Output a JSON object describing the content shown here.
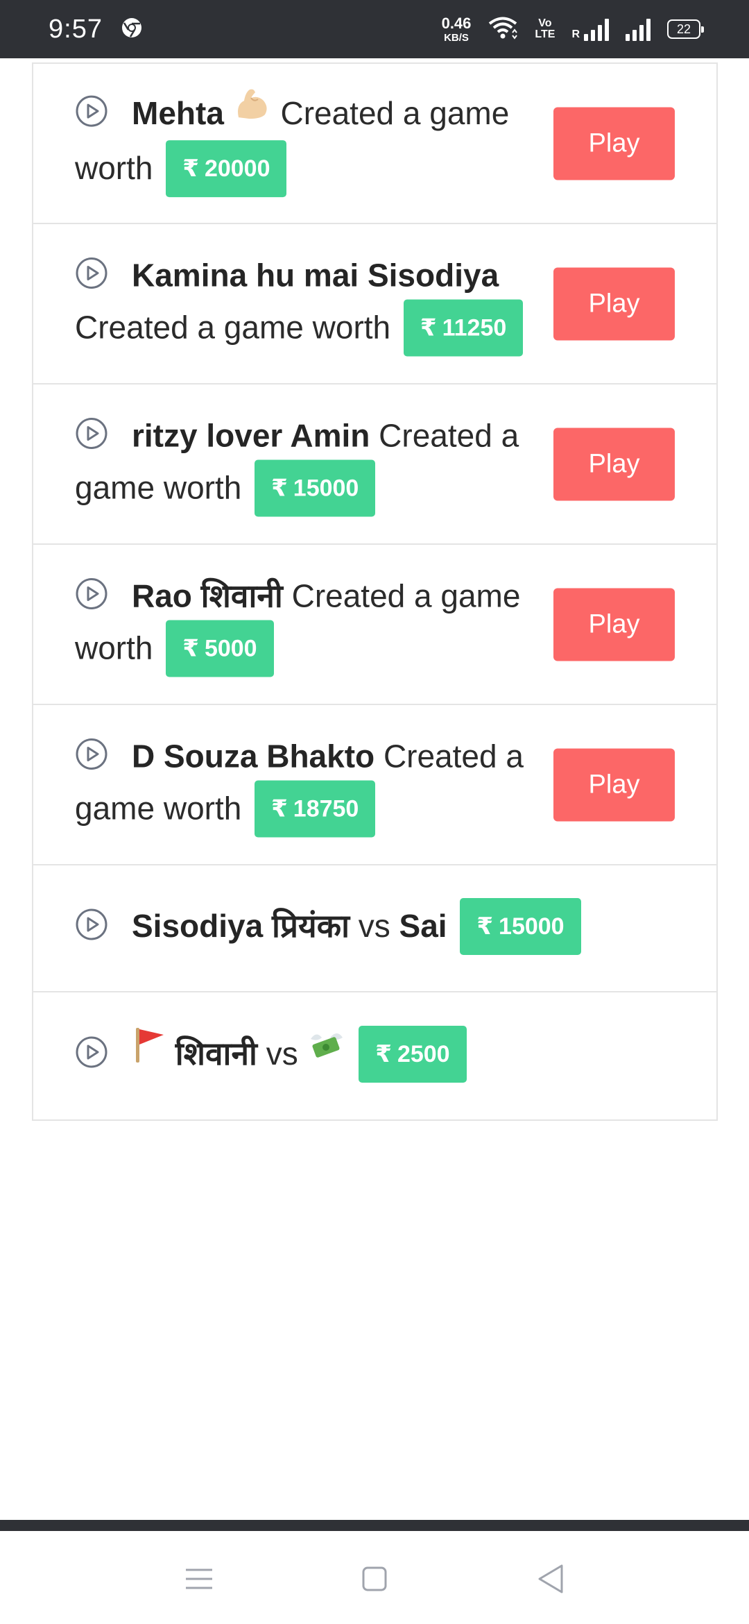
{
  "status_bar": {
    "time": "9:57",
    "net_speed_value": "0.46",
    "net_speed_unit": "KB/S",
    "volte_top": "Vo",
    "volte_bottom": "LTE",
    "roaming": "R",
    "battery": "22"
  },
  "colors": {
    "play_button": "#fc6767",
    "amount_badge": "#43d393",
    "status_bar": "#2f3136"
  },
  "currency_symbol": "₹",
  "games": [
    {
      "player": "Mehta",
      "emoji": "muscle-emoji",
      "text": "Created a game worth",
      "amount": "20000",
      "button": "Play"
    },
    {
      "player": "Kamina hu mai Sisodiya",
      "text": "Created a game worth",
      "amount": "11250",
      "button": "Play"
    },
    {
      "player": "ritzy lover Amin",
      "text": "Created a game worth",
      "amount": "15000",
      "button": "Play"
    },
    {
      "player": "Rao शिवानी",
      "text": "Created a game worth",
      "amount": "5000",
      "button": "Play"
    },
    {
      "player": "D Souza Bhakto",
      "text": "Created a game worth",
      "amount": "18750",
      "button": "Play"
    }
  ],
  "matches": [
    {
      "player1": "Sisodiya प्रियंका",
      "vs": "vs",
      "player2": "Sai",
      "amount": "15000"
    },
    {
      "player1_emoji": "red-flag-emoji",
      "player1": "शिवानी",
      "vs": "vs",
      "player2_emoji": "money-with-wings-emoji",
      "amount": "2500"
    }
  ],
  "nav": {
    "menu": "menu-icon",
    "home": "home-square-icon",
    "back": "back-triangle-icon"
  }
}
